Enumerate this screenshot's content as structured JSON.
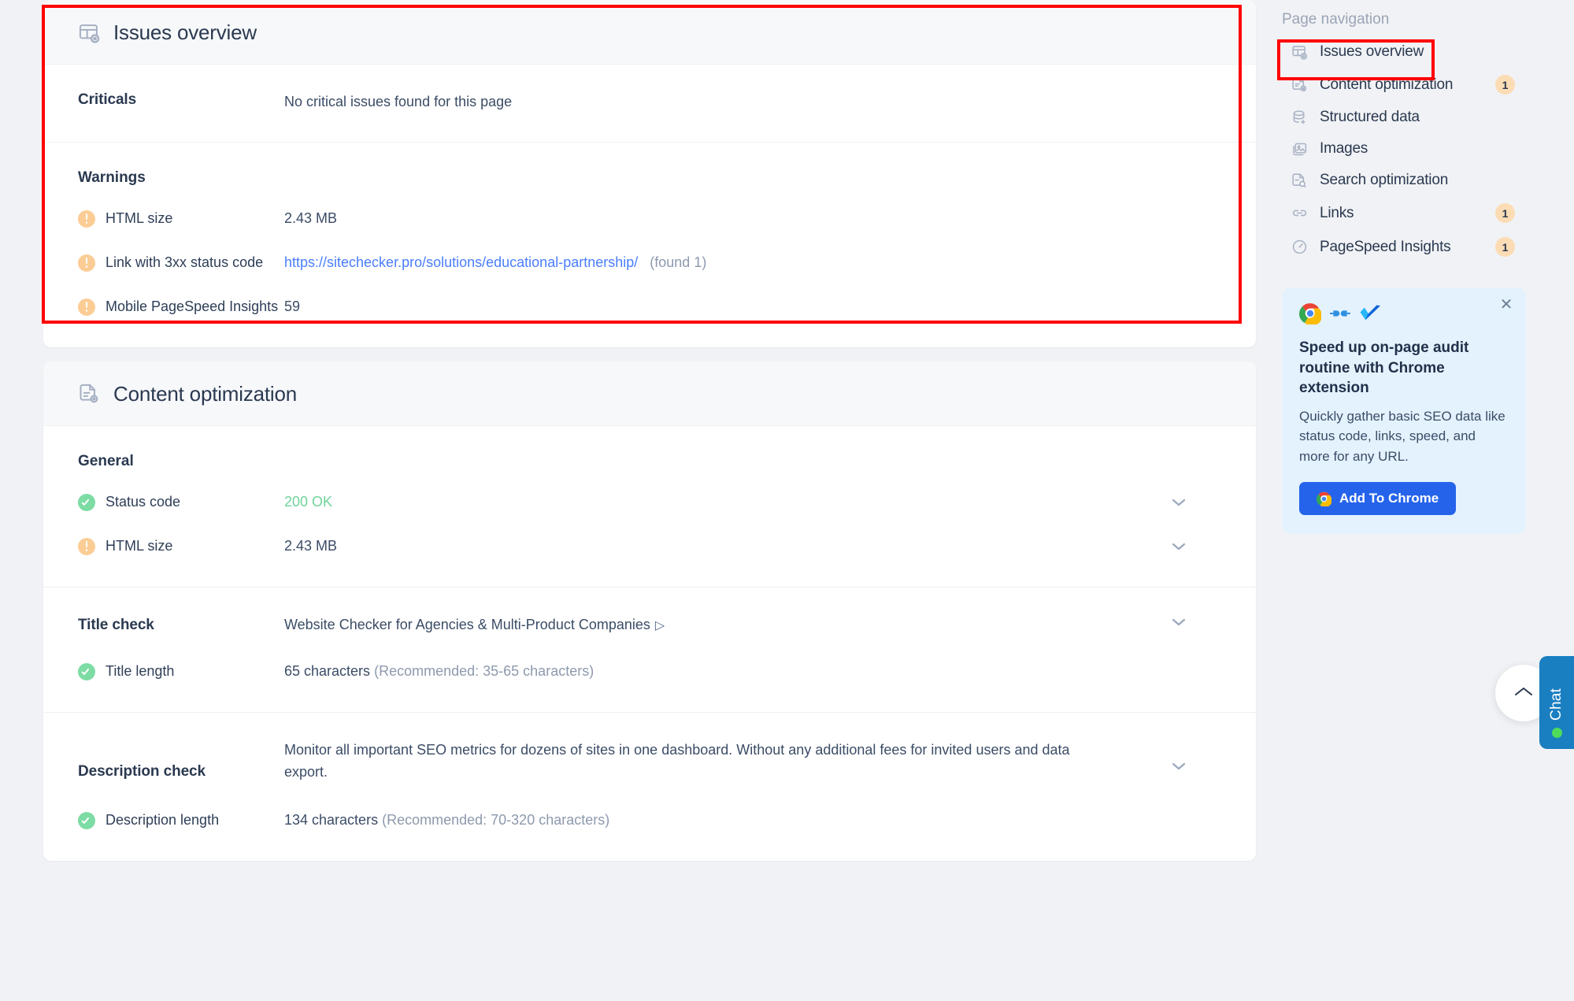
{
  "colors": {
    "accent_blue": "#4a7efd",
    "warning": "#fbcd95",
    "success": "#7ddca4",
    "annotation": "#ff0000",
    "badge_bg": "#fcdcb4",
    "promo_bg": "#e3f2fd",
    "promo_button": "#2563eb",
    "chat_blue": "#1a7fc1",
    "status_green": "#4ddb5b"
  },
  "issues_overview": {
    "title": "Issues overview",
    "icon": "issues-overview-icon",
    "criticals": {
      "label": "Criticals",
      "value": "No critical issues found for this page"
    },
    "warnings": {
      "label": "Warnings",
      "items": [
        {
          "icon": "warning-icon",
          "name": "HTML size",
          "value": "2.43 MB"
        },
        {
          "icon": "warning-icon",
          "name": "Link with 3xx status code",
          "link": "https://sitechecker.pro/solutions/educational-partnership/",
          "note": "(found 1)"
        },
        {
          "icon": "warning-icon",
          "name": "Mobile PageSpeed Insights",
          "value": "59"
        }
      ]
    }
  },
  "content_optimization": {
    "title": "Content optimization",
    "icon": "content-optimization-icon",
    "general": {
      "label": "General",
      "items": [
        {
          "icon": "success-icon",
          "name": "Status code",
          "value": "200 OK",
          "value_style": "green"
        },
        {
          "icon": "warning-icon",
          "name": "HTML size",
          "value": "2.43 MB",
          "value_style": "normal"
        }
      ]
    },
    "title_check": {
      "label": "Title check",
      "value": "Website Checker for Agencies & Multi-Product Companies",
      "trailing_glyph": "▷",
      "length": {
        "icon": "success-icon",
        "name": "Title length",
        "value": "65 characters",
        "recommended": "(Recommended: 35-65 characters)"
      }
    },
    "description_check": {
      "label": "Description check",
      "value": "Monitor all important SEO metrics for dozens of sites in one dashboard. Without any additional fees for invited users and data export.",
      "length": {
        "icon": "success-icon",
        "name": "Description length",
        "value": "134 characters",
        "recommended": "(Recommended: 70-320 characters)"
      }
    }
  },
  "page_navigation": {
    "title": "Page navigation",
    "items": [
      {
        "label": "Issues overview",
        "icon": "issues-overview-icon",
        "badge": "",
        "selected": true
      },
      {
        "label": "Content optimization",
        "icon": "content-optimization-icon",
        "badge": "1",
        "selected": false
      },
      {
        "label": "Structured data",
        "icon": "structured-data-icon",
        "badge": "",
        "selected": false
      },
      {
        "label": "Images",
        "icon": "images-icon",
        "badge": "",
        "selected": false
      },
      {
        "label": "Search optimization",
        "icon": "search-optimization-icon",
        "badge": "",
        "selected": false
      },
      {
        "label": "Links",
        "icon": "links-icon",
        "badge": "1",
        "selected": false
      },
      {
        "label": "PageSpeed Insights",
        "icon": "pagespeed-icon",
        "badge": "1",
        "selected": false
      }
    ]
  },
  "promo": {
    "close_icon": "close-icon",
    "logos": [
      "chrome-logo-icon",
      "plug-connector-icon",
      "sitechecker-logo-icon"
    ],
    "title": "Speed up on-page audit routine with Chrome extension",
    "text": "Quickly gather basic SEO data like status code, links, speed, and more for any URL.",
    "button_label": "Add To Chrome",
    "button_icon": "chrome-logo-icon"
  },
  "widgets": {
    "scroll_top_icon": "chevron-up-icon",
    "chat_label": "Chat",
    "chat_status_icon": "online-status-dot"
  }
}
